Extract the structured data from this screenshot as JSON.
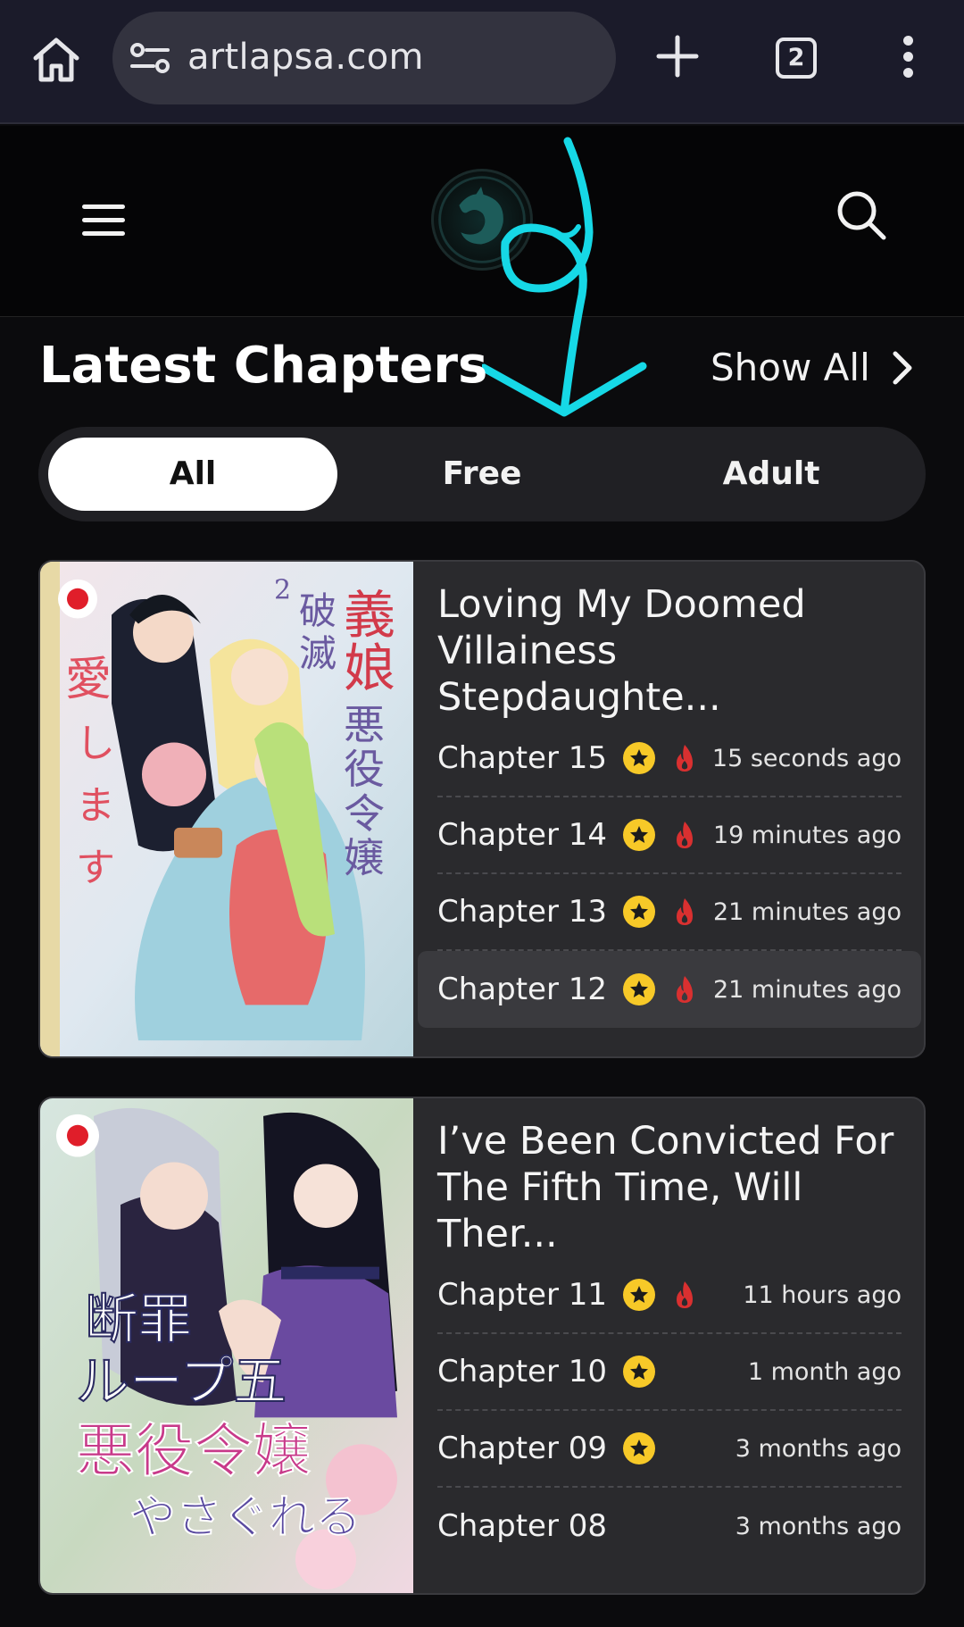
{
  "browser": {
    "url": "artlapsa.com",
    "tab_count": "2"
  },
  "section": {
    "title": "Latest Chapters",
    "show_all": "Show All"
  },
  "filters": [
    {
      "label": "All",
      "active": true
    },
    {
      "label": "Free",
      "active": false
    },
    {
      "label": "Adult",
      "active": false
    }
  ],
  "series": [
    {
      "title": "Loving My Doomed Villainess Stepdaughte...",
      "chapters": [
        {
          "name": "Chapter 15",
          "premium": true,
          "hot": true,
          "time": "15 seconds ago"
        },
        {
          "name": "Chapter 14",
          "premium": true,
          "hot": true,
          "time": "19 minutes ago"
        },
        {
          "name": "Chapter 13",
          "premium": true,
          "hot": true,
          "time": "21 minutes ago"
        },
        {
          "name": "Chapter 12",
          "premium": true,
          "hot": true,
          "time": "21 minutes ago"
        }
      ]
    },
    {
      "title": "I’ve Been Convicted For The Fifth Time, Will Ther...",
      "chapters": [
        {
          "name": "Chapter 11",
          "premium": true,
          "hot": true,
          "time": "11 hours ago"
        },
        {
          "name": "Chapter 10",
          "premium": true,
          "hot": false,
          "time": "1 month ago"
        },
        {
          "name": "Chapter 09",
          "premium": true,
          "hot": false,
          "time": "3 months ago"
        },
        {
          "name": "Chapter 08",
          "premium": false,
          "hot": false,
          "time": "3 months ago"
        }
      ]
    }
  ],
  "colors": {
    "accent_annotation": "#16d8e6",
    "star": "#f7c928",
    "fire": "#d93030"
  }
}
